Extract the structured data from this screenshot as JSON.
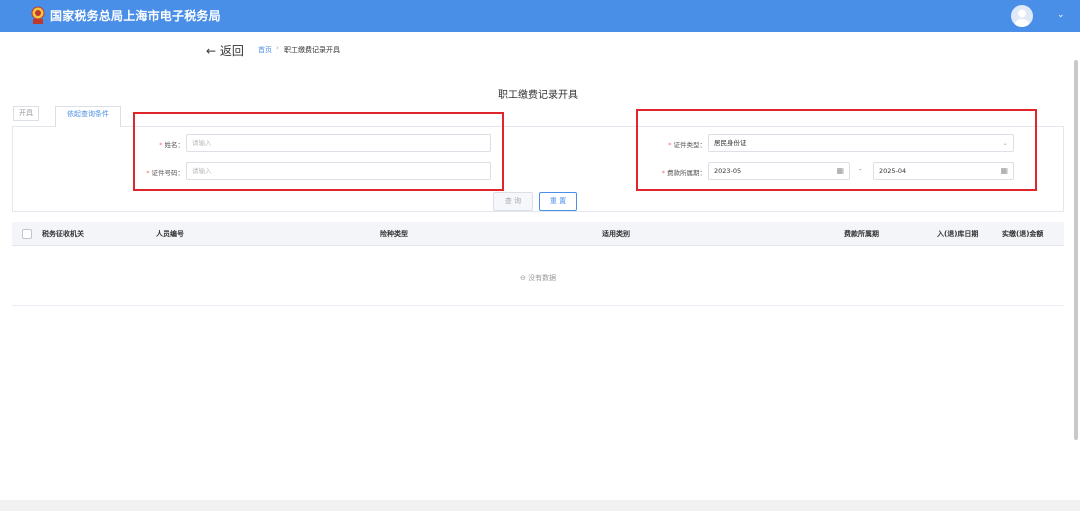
{
  "header": {
    "title": "国家税务总局上海市电子税务局",
    "brand_color": "#4a8fe7",
    "avatar_icon": "user-avatar-icon",
    "dropdown_icon": "chevron-down-icon"
  },
  "nav": {
    "back_label": "← 返回",
    "breadcrumb_home": "首页",
    "breadcrumb_sep": "›",
    "breadcrumb_current": "职工缴费记录开具"
  },
  "page": {
    "title": "职工缴费记录开具"
  },
  "tabs": {
    "kai": "开具",
    "query": "依起查询条件"
  },
  "form": {
    "required_mark": "*",
    "name_label": "姓名：",
    "name_placeholder": "请输入",
    "idno_label": "证件号码：",
    "idno_placeholder": "请输入",
    "idtype_label": "证件类型：",
    "idtype_value": "居民身份证",
    "period_label": "费款所属期：",
    "period_start": "2023-05",
    "period_sep": "-",
    "period_end": "2025-04",
    "query_label": "查 询",
    "reset_label": "重 置"
  },
  "table": {
    "columns": [
      "税务征收机关",
      "人员编号",
      "险种类型",
      "适用类别",
      "费款所属期",
      "入(退)库日期",
      "实缴(退)金额"
    ],
    "empty_text": "没有数据"
  },
  "highlight_color": "#e0262b"
}
